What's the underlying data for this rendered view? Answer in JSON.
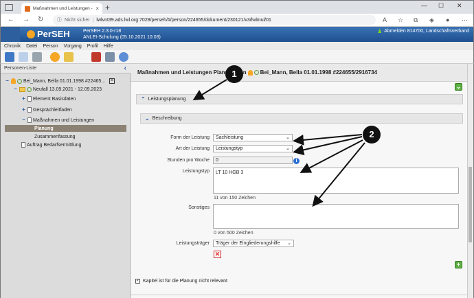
{
  "browser": {
    "tab_title": "Maßnahmen und Leistungen - P",
    "tab_close": "×",
    "new_tab": "+",
    "url_warning": "Nicht sicher",
    "url_sep": "|",
    "url": "lwlvnt39.ads.lwl.org:7028/perseh/#/person/224655/dokument/230121/v3/lwlmul/01",
    "window_controls": [
      "—",
      "☐",
      "✕"
    ]
  },
  "app": {
    "name": "PerSEH",
    "version": "PerSEH 2.3.0-r18",
    "environment": "ANLEI-Schulung (05.10.2021 10:03)",
    "user": "Abmelden 814700, Landschaftsverband"
  },
  "menu": [
    "Chronik",
    "Datei",
    "Person",
    "Vorgang",
    "Profil",
    "Hilfe"
  ],
  "left_panel": {
    "title": "Personen-Liste",
    "tree": [
      {
        "label": "Bei_Mann, Bella 01.01.1998 #22465..."
      },
      {
        "label": "Neufall 13.09.2021 - 12.09.2023"
      },
      {
        "label": "Element Basisdaten"
      },
      {
        "label": "Gesprächleitfaden"
      },
      {
        "label": "Maßnahmen und Leistungen"
      },
      {
        "label": "Planung"
      },
      {
        "label": "Zusammenfassung"
      },
      {
        "label": "Auftrag Bedarfsermittlung"
      }
    ]
  },
  "main": {
    "title": "Maßnahmen und Leistungen Planung von",
    "title_person": "Bei_Mann, Bella 01.01.1998 #224655/2916734",
    "section_planning": "Leistungsplanung",
    "section_description": "Beschreibung",
    "fields": {
      "form_label": "Form der Leistung",
      "form_value": "Sachleistung",
      "art_label": "Art der Leistung",
      "art_value": "Leistungstyp",
      "hours_label": "Stunden pro Woche",
      "hours_value": "0",
      "type_label": "Leistungstyp",
      "type_value": "LT 10 HGB 3",
      "type_counter": "11 von 150 Zeichen",
      "other_label": "Sonstiges",
      "other_value": "",
      "other_counter": "0 von 500 Zeichen",
      "carrier_label": "Leistungsträger",
      "carrier_value": "Träger der Eingliederungshilfe"
    },
    "checkbox_label": "Kapitel ist für die Planung nicht relevant"
  },
  "annotations": {
    "badge1": "1",
    "badge2": "2"
  },
  "icons": [
    "tab-favicon",
    "back-icon",
    "forward-icon",
    "reload-icon",
    "home-icon",
    "info-icon",
    "plus-icon",
    "delete-icon",
    "chevron-up-icon",
    "chevron-down-icon",
    "collapse-icon"
  ]
}
